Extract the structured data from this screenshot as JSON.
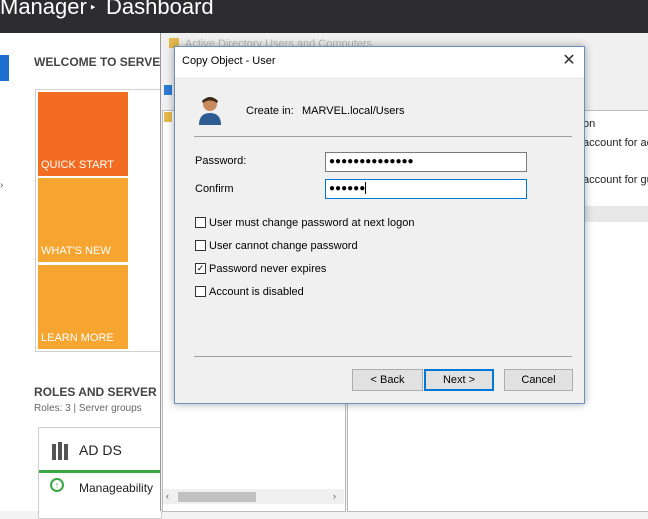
{
  "server_manager": {
    "title": "Manager",
    "separator": "‣",
    "page": "Dashboard",
    "welcome": "WELCOME TO SERVE",
    "tiles": [
      "QUICK START",
      "WHAT'S NEW",
      "LEARN MORE"
    ],
    "roles_title": "ROLES AND SERVER",
    "roles_sub": "Roles: 3  |  Server groups",
    "adds_label": "AD DS",
    "manageability": "Manageability",
    "tile_colors": {
      "quick_start": "#f26d21",
      "whats_new": "#f7a531",
      "learn_more": "#f7a531"
    }
  },
  "aduc": {
    "title": "Active Directory Users and Computers",
    "list_snippets": [
      "on",
      "account for ac",
      "account for gu"
    ]
  },
  "dialog": {
    "title": "Copy Object - User",
    "close_glyph": "✕",
    "create_in_label": "Create in:",
    "create_in_value": "MARVEL.local/Users",
    "password_label": "Password:",
    "password_value": "●●●●●●●●●●●●●●",
    "confirm_label": "Confirm",
    "confirm_value": "●●●●●●",
    "checkboxes": [
      {
        "label": "User must change password at next logon",
        "checked": false
      },
      {
        "label": "User cannot change password",
        "checked": false
      },
      {
        "label": "Password never expires",
        "checked": true
      },
      {
        "label": "Account is disabled",
        "checked": false
      }
    ],
    "buttons": {
      "back": "< Back",
      "next": "Next >",
      "cancel": "Cancel"
    },
    "accent": "#0078d7"
  }
}
